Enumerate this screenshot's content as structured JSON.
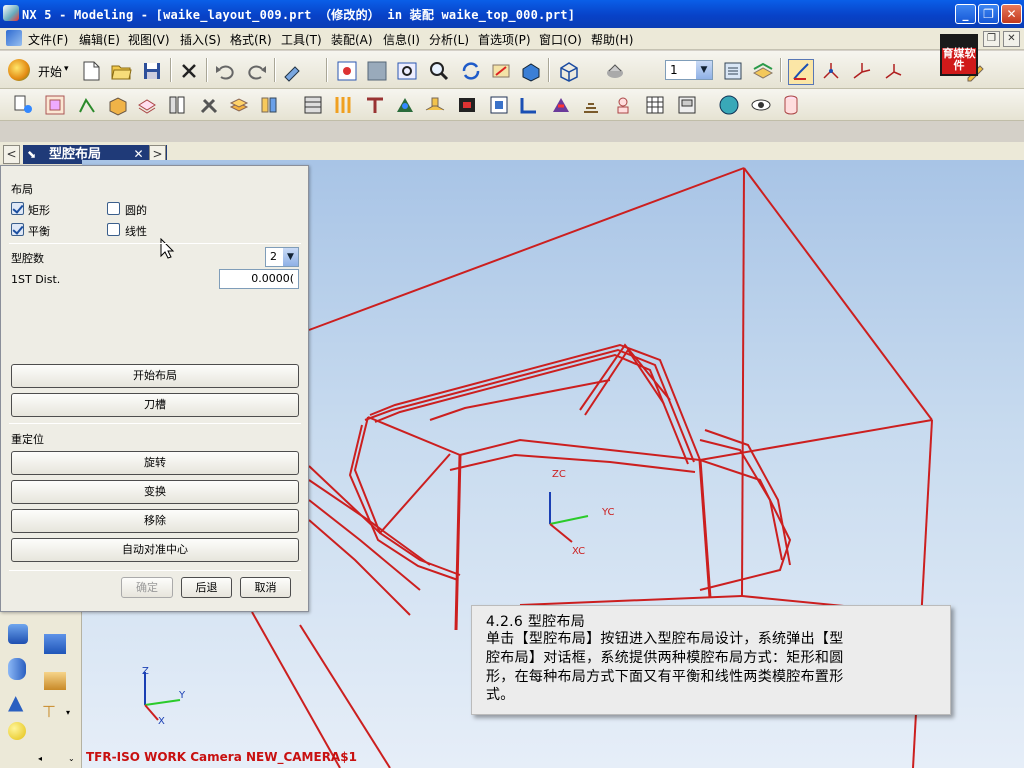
{
  "window": {
    "title": "NX 5 - Modeling - [waike_layout_009.prt （修改的）  in 装配 waike_top_000.prt]"
  },
  "menu": {
    "items": [
      "文件(F)",
      "编辑(E)",
      "视图(V)",
      "插入(S)",
      "格式(R)",
      "工具(T)",
      "装配(A)",
      "信息(I)",
      "分析(L)",
      "首选项(P)",
      "窗口(O)",
      "帮助(H)"
    ]
  },
  "toolbar": {
    "start_label": "开始",
    "layer_value": "1"
  },
  "logo": {
    "text": "育媒软件"
  },
  "tab": {
    "label": "型腔布局"
  },
  "dialog": {
    "layout_group": "布局",
    "rect_label": "矩形",
    "round_label": "圆的",
    "balanced_label": "平衡",
    "linear_label": "线性",
    "rect_checked": true,
    "round_checked": false,
    "balanced_checked": true,
    "linear_checked": false,
    "cavity_count_label": "型腔数",
    "cavity_count_value": "2",
    "first_dist_label": "1ST Dist.",
    "first_dist_value": "0.0000(",
    "start_layout_button": "开始布局",
    "slot_button": "刀槽",
    "reposition_group": "重定位",
    "rotate_button": "旋转",
    "transform_button": "变换",
    "remove_button": "移除",
    "auto_center_button": "自动对准中心",
    "ok_button": "确定",
    "back_button": "后退",
    "cancel_button": "取消"
  },
  "viewport": {
    "axis_zc": "ZC",
    "axis_yc": "YC",
    "axis_xc": "XC",
    "mini_z": "Z",
    "mini_y": "Y",
    "mini_x": "X",
    "camera_label": "TFR-ISO WORK Camera NEW_CAMERA$1",
    "model_color": "#cc1f1f"
  },
  "caption": {
    "line1": "4.2.6 型腔布局",
    "line2": "单击【型腔布局】按钮进入型腔布局设计，系统弹出【型",
    "line3": "腔布局】对话框，系统提供两种模腔布局方式：矩形和圆",
    "line4": "形，在每种布局方式下面又有平衡和线性两类模腔布置形",
    "line5": "式。"
  }
}
